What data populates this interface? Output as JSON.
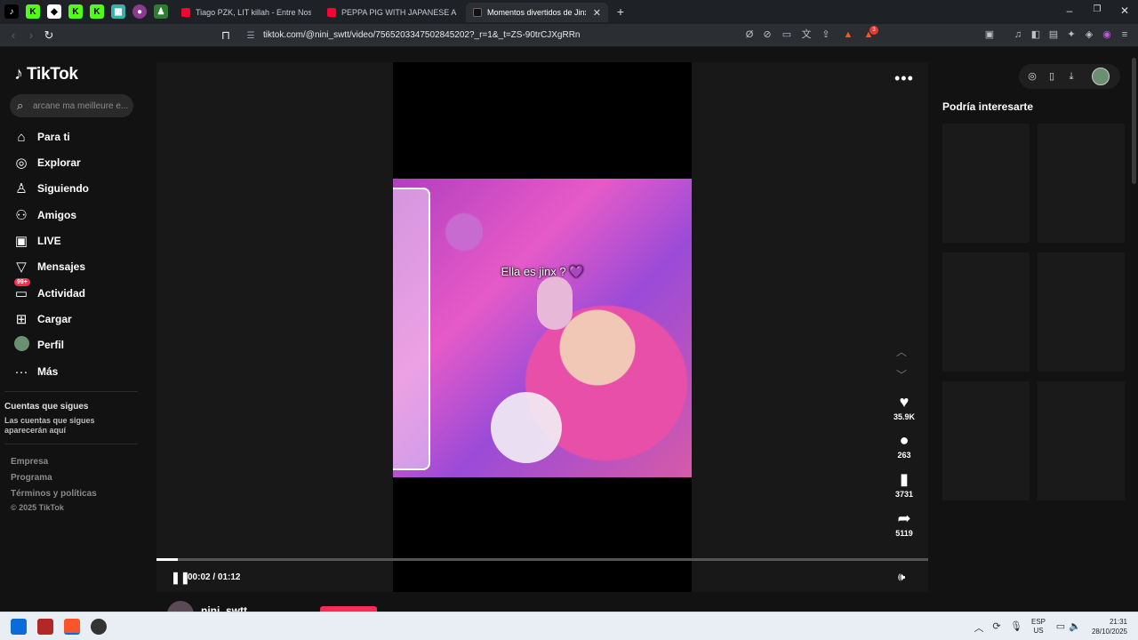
{
  "browser": {
    "tabs": [
      {
        "title": "Tiago PZK, LIT killah - Entre Nosotros",
        "favicon_color": "#ff0033"
      },
      {
        "title": "PEPPA PIG WITH JAPANESE AND ENGLISH",
        "favicon_color": "#ff0033"
      },
      {
        "title": "Momentos divertidos de Jinx",
        "favicon_color": "#111111"
      }
    ],
    "close_glyph": "✕",
    "new_tab_glyph": "+",
    "url": "tiktok.com/@nini_swtt/video/7565203347502845202?_r=1&_t=ZS-90trCJXgRRn",
    "ext_badge_count": "3"
  },
  "sidebar": {
    "logo_text": "TikTok",
    "search_placeholder": "arcane ma meilleure e...",
    "nav": [
      {
        "label": "Para ti",
        "icon": "home-icon"
      },
      {
        "label": "Explorar",
        "icon": "compass-icon"
      },
      {
        "label": "Siguiendo",
        "icon": "following-icon"
      },
      {
        "label": "Amigos",
        "icon": "friends-icon"
      },
      {
        "label": "LIVE",
        "icon": "live-icon"
      },
      {
        "label": "Mensajes",
        "icon": "messages-icon"
      },
      {
        "label": "Actividad",
        "icon": "activity-icon",
        "badge": "99+"
      },
      {
        "label": "Cargar",
        "icon": "upload-icon"
      },
      {
        "label": "Perfil",
        "icon": "avatar"
      },
      {
        "label": "Más",
        "icon": "more-icon"
      }
    ],
    "following_heading": "Cuentas que sigues",
    "following_text": "Las cuentas que sigues aparecerán aquí",
    "footer": [
      "Empresa",
      "Programa",
      "Términos y políticas"
    ],
    "copyright": "© 2025 TikTok"
  },
  "video": {
    "caption": "Ella es jinx ? 💜",
    "likes": "35.9K",
    "comments": "263",
    "saves": "3731",
    "shares": "5119",
    "time": "00:02 / 01:12",
    "progress": 0.028,
    "author": "nini_swtt"
  },
  "right": {
    "recommend_title": "Podría interesarte"
  },
  "taskbar": {
    "lang_top": "ESP",
    "lang_bottom": "US",
    "time": "21:31",
    "date": "28/10/2025"
  },
  "colors": {
    "accent": "#fe2c55",
    "page_bg": "#121212"
  }
}
